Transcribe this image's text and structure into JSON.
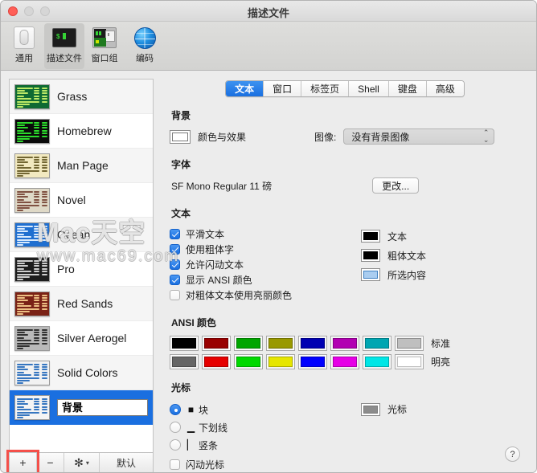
{
  "window": {
    "title": "描述文件",
    "lights": [
      "close",
      "minimize",
      "maximize"
    ]
  },
  "toolbar": {
    "items": [
      {
        "label": "通用",
        "icon": "general-toggle-icon",
        "active": false
      },
      {
        "label": "描述文件",
        "icon": "terminal-profile-icon",
        "active": true
      },
      {
        "label": "窗口组",
        "icon": "window-group-icon",
        "active": false
      },
      {
        "label": "编码",
        "icon": "globe-icon",
        "active": false
      }
    ]
  },
  "sidebar": {
    "profiles": [
      {
        "name": "Grass",
        "bg": "#0f6a33",
        "fg": "#c6f06a",
        "selected": false
      },
      {
        "name": "Homebrew",
        "bg": "#0a0a0a",
        "fg": "#2ee62e",
        "selected": false
      },
      {
        "name": "Man Page",
        "bg": "#f2e9c0",
        "fg": "#6a5f2a",
        "selected": false
      },
      {
        "name": "Novel",
        "bg": "#dfd9c7",
        "fg": "#7a4a3a",
        "selected": false
      },
      {
        "name": "Ocean",
        "bg": "#1f6fd0",
        "fg": "#e4f0ff",
        "selected": false
      },
      {
        "name": "Pro",
        "bg": "#1d1d1d",
        "fg": "#d8d8d8",
        "selected": false
      },
      {
        "name": "Red Sands",
        "bg": "#7a2216",
        "fg": "#f3c98a",
        "selected": false
      },
      {
        "name": "Silver Aerogel",
        "bg": "#b9b9b9",
        "fg": "#2a2a2a",
        "selected": false
      },
      {
        "name": "Solid Colors",
        "bg": "#f2f2f2",
        "fg": "#2b6fbd",
        "selected": false
      },
      {
        "name": "背景",
        "bg": "#f4f4f4",
        "fg": "#2b6fbd",
        "selected": true,
        "editing": true
      }
    ],
    "footer": {
      "add_label": "+",
      "remove_label": "−",
      "gear_label": "✻",
      "gear_chevron": "▾",
      "default_label": "默认",
      "highlighted": "add-button"
    }
  },
  "main": {
    "tabs": [
      {
        "label": "文本",
        "active": true
      },
      {
        "label": "窗口",
        "active": false
      },
      {
        "label": "标签页",
        "active": false
      },
      {
        "label": "Shell",
        "active": false
      },
      {
        "label": "键盘",
        "active": false
      },
      {
        "label": "高级",
        "active": false
      }
    ],
    "background": {
      "title": "背景",
      "color_effects_label": "颜色与效果",
      "color_well": "#ffffff",
      "image_label": "图像:",
      "image_value": "没有背景图像",
      "image_arrows": "⌃⌄"
    },
    "font": {
      "title": "字体",
      "value": "SF Mono Regular 11 磅",
      "change_button": "更改..."
    },
    "text": {
      "title": "文本",
      "checkboxes": [
        {
          "label": "平滑文本",
          "checked": true
        },
        {
          "label": "使用粗体字",
          "checked": true
        },
        {
          "label": "允许闪动文本",
          "checked": true
        },
        {
          "label": "显示 ANSI 颜色",
          "checked": true
        },
        {
          "label": "对粗体文本使用亮丽颜色",
          "checked": false
        }
      ],
      "color_wells": [
        {
          "label": "文本",
          "color": "#000000",
          "border": "#000000"
        },
        {
          "label": "粗体文本",
          "color": "#000000",
          "border": "#000000"
        },
        {
          "label": "所选内容",
          "color": "#aacdf0",
          "border": "#3f7fc0"
        }
      ]
    },
    "ansi": {
      "title": "ANSI 颜色",
      "rows": [
        {
          "label": "标准",
          "colors": [
            "#000000",
            "#990000",
            "#00a600",
            "#999900",
            "#0000b2",
            "#b200b2",
            "#00a6b2",
            "#bfbfbf"
          ]
        },
        {
          "label": "明亮",
          "colors": [
            "#666666",
            "#e60000",
            "#00d900",
            "#e6e600",
            "#0000ff",
            "#e600e6",
            "#00e6e6",
            "#ffffff"
          ]
        }
      ]
    },
    "cursor": {
      "title": "光标",
      "options": [
        {
          "label": "块",
          "glyph": "■",
          "selected": true
        },
        {
          "label": "下划线",
          "glyph": "▁",
          "selected": false
        },
        {
          "label": "竖条",
          "glyph": "▏",
          "selected": false
        }
      ],
      "blink_label": "闪动光标",
      "blink_checked": false,
      "color_label": "光标",
      "color_well": "#8c8c8c"
    },
    "help_label": "?"
  },
  "watermark": {
    "main": "Mac天空",
    "sub": "www.mac69.com"
  },
  "colors": {
    "accent": "#1a6fe0",
    "highlight_box": "#f4504a",
    "window_bg": "#ececec"
  }
}
